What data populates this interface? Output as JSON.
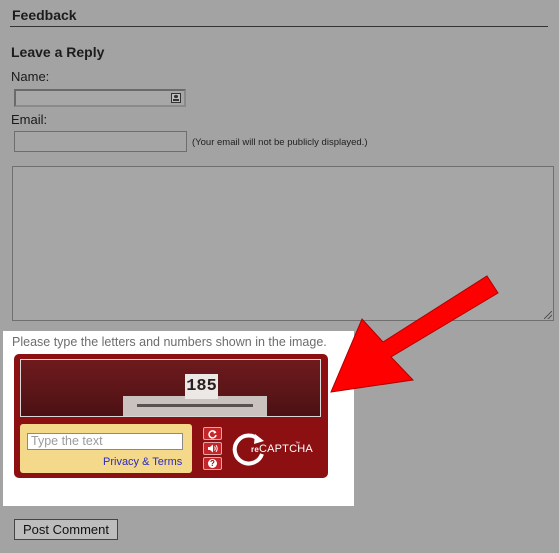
{
  "section": {
    "title": "Feedback"
  },
  "reply_form": {
    "title": "Leave a Reply",
    "name_label": "Name:",
    "email_label": "Email:",
    "email_note": "(Your email will not be publicly displayed.)",
    "submit_label": "Post Comment"
  },
  "captcha": {
    "instruction": "Please type the letters and numbers shown in the image.",
    "image_text": "185",
    "input_placeholder": "Type the text",
    "privacy_link": "Privacy & Terms",
    "logo_prefix": "re",
    "logo_text": "CAPTCHA",
    "logo_tm": "™",
    "reload_icon": "reload-icon",
    "audio_icon": "audio-icon",
    "help_icon": "help-icon",
    "help_glyph": "?",
    "brand_color": "#8c0f11",
    "panel_color": "#f4d98a"
  },
  "overlay": {
    "arrow_color": "#ff0000"
  }
}
